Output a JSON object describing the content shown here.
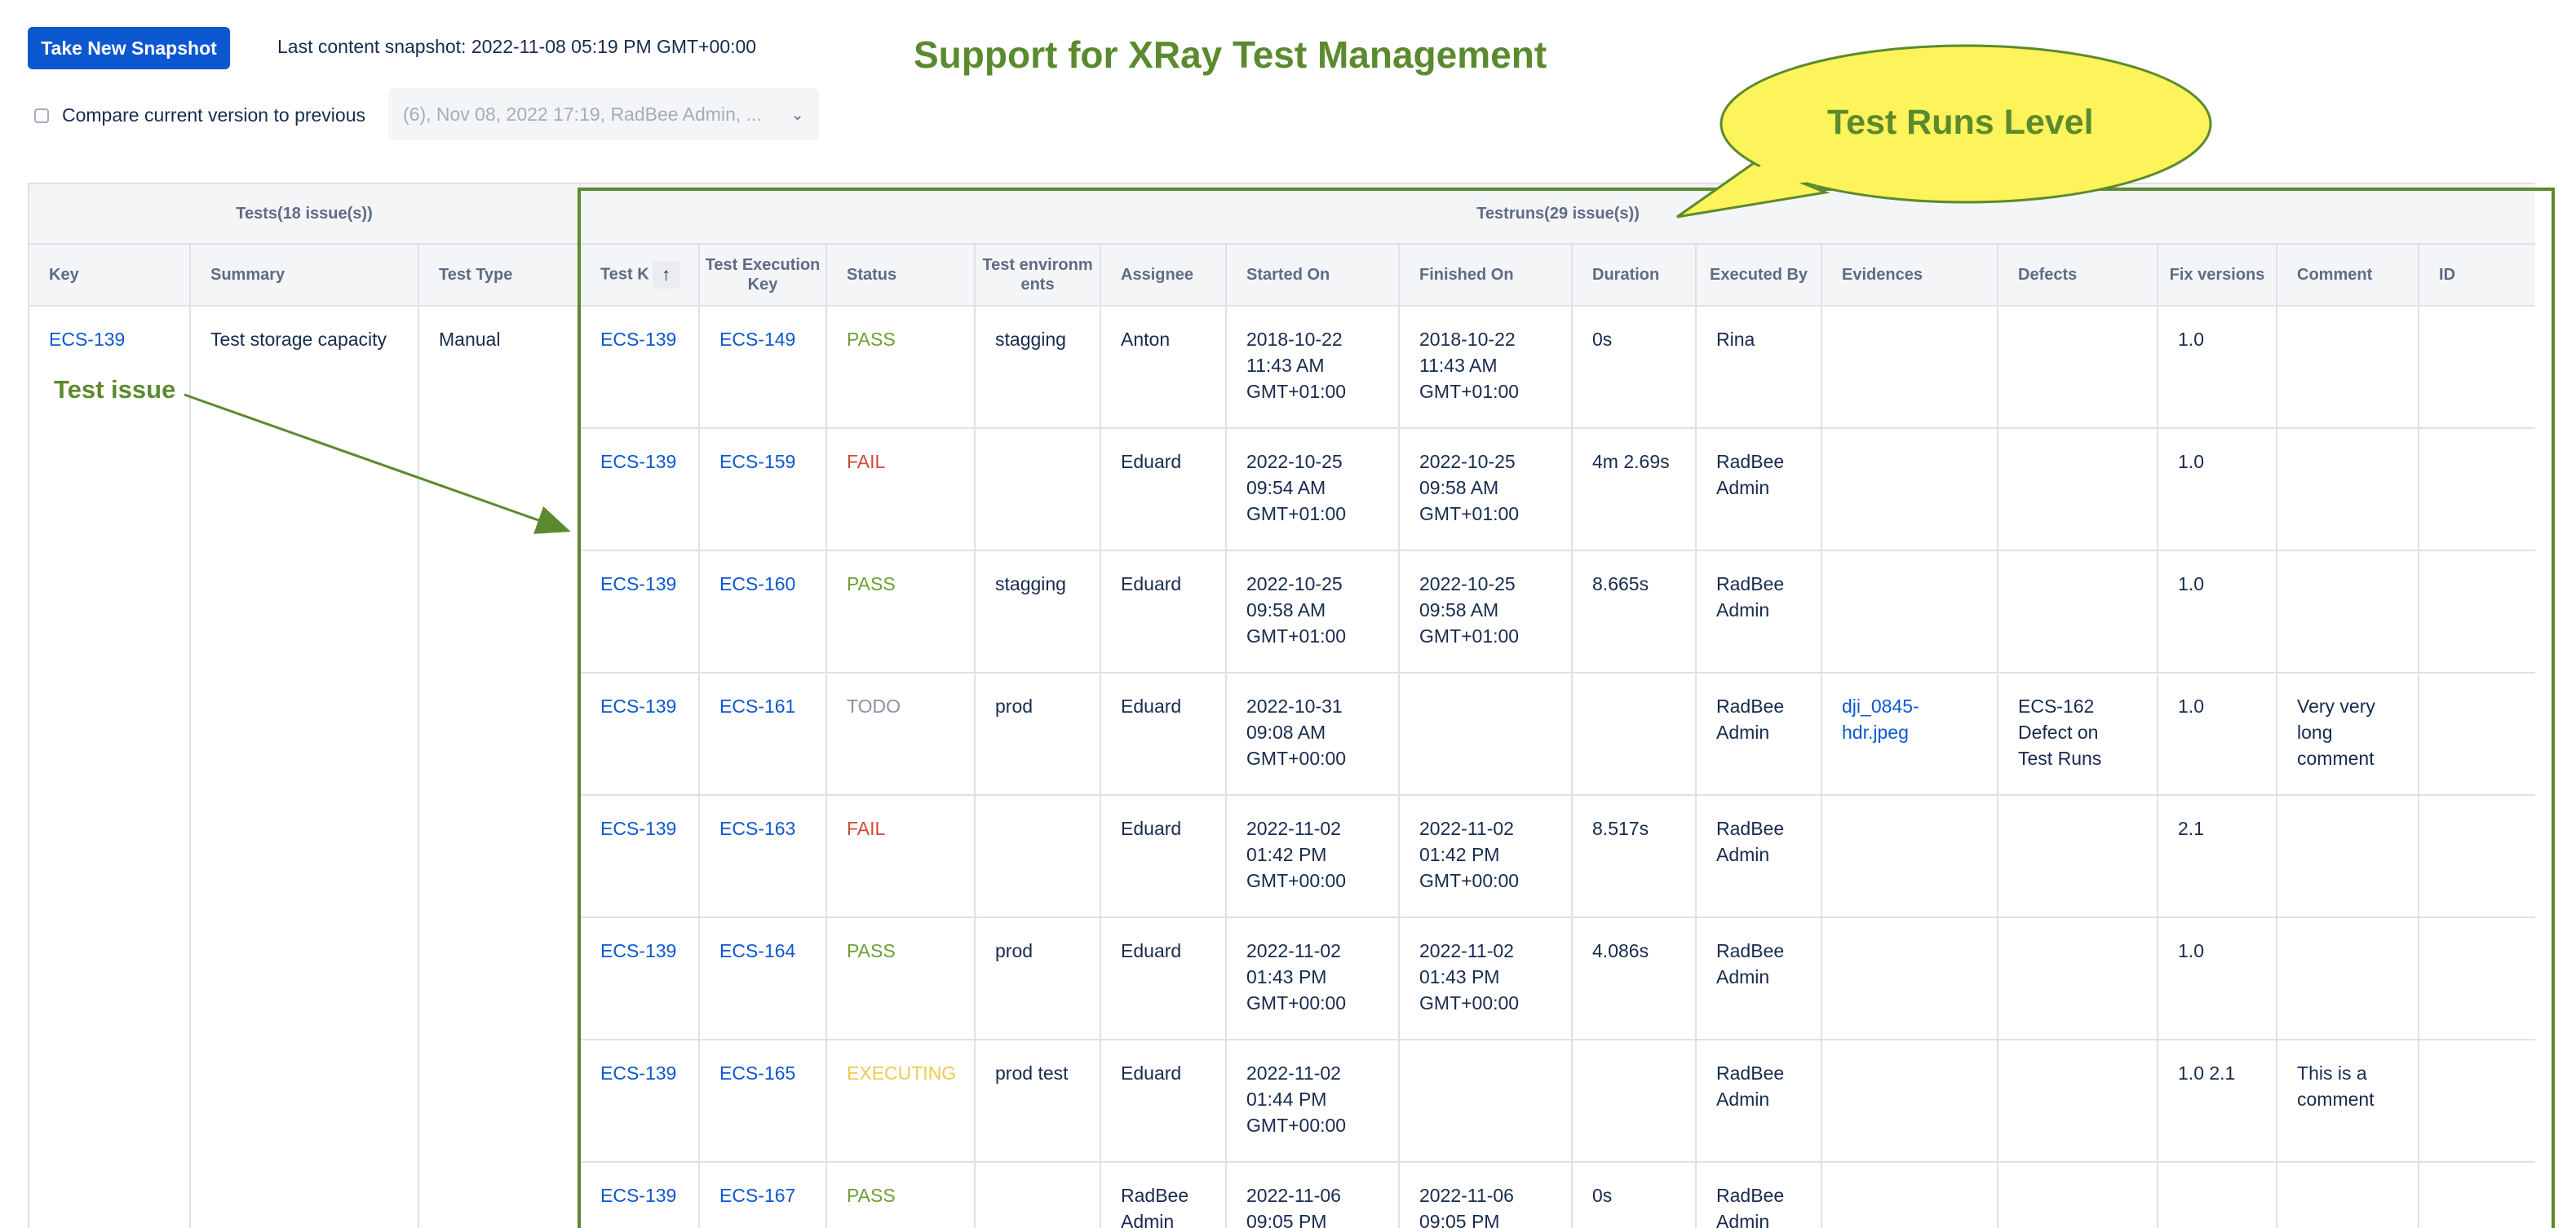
{
  "toolbar": {
    "snapshot_button": "Take New Snapshot",
    "last_snapshot": "Last content snapshot: 2022-11-08 05:19 PM GMT+00:00",
    "compare_label": "Compare current version to previous",
    "version_select_value": "(6), Nov 08, 2022 17:19, RadBee Admin, ..."
  },
  "annotations": {
    "title": "Support for XRay Test Management",
    "bubble": "Test Runs Level",
    "test_issue": "Test issue",
    "color": "#5b8a2e",
    "bubble_fill": "#fdf35a"
  },
  "table": {
    "groups": {
      "tests": "Tests(18 issue(s))",
      "testruns": "Testruns(29 issue(s))"
    },
    "columns": {
      "key": "Key",
      "summary": "Summary",
      "test_type": "Test Type",
      "test_key": "Test K",
      "test_exec_key": "Test Execution Key",
      "status": "Status",
      "test_env": "Test environments",
      "assignee": "Assignee",
      "started_on": "Started On",
      "finished_on": "Finished On",
      "duration": "Duration",
      "executed_by": "Executed By",
      "evidences": "Evidences",
      "defects": "Defects",
      "fix_versions": "Fix versions",
      "comment": "Comment",
      "id": "ID"
    },
    "test": {
      "key": "ECS-139",
      "summary": "Test storage capacity",
      "type": "Manual"
    },
    "runs": [
      {
        "test_key": "ECS-139",
        "exec_key": "ECS-149",
        "status": "PASS",
        "env": "stagging",
        "assignee": "Anton",
        "started": "2018-10-22 11:43 AM GMT+01:00",
        "finished": "2018-10-22 11:43 AM GMT+01:00",
        "duration": "0s",
        "executed_by": "Rina",
        "evidence": "",
        "defects": "",
        "fix": "1.0",
        "comment": ""
      },
      {
        "test_key": "ECS-139",
        "exec_key": "ECS-159",
        "status": "FAIL",
        "env": "",
        "assignee": "Eduard",
        "started": "2022-10-25 09:54 AM GMT+01:00",
        "finished": "2022-10-25 09:58 AM GMT+01:00",
        "duration": "4m 2.69s",
        "executed_by": "RadBee Admin",
        "evidence": "",
        "defects": "",
        "fix": "1.0",
        "comment": ""
      },
      {
        "test_key": "ECS-139",
        "exec_key": "ECS-160",
        "status": "PASS",
        "env": "stagging",
        "assignee": "Eduard",
        "started": "2022-10-25 09:58 AM GMT+01:00",
        "finished": "2022-10-25 09:58 AM GMT+01:00",
        "duration": "8.665s",
        "executed_by": "RadBee Admin",
        "evidence": "",
        "defects": "",
        "fix": "1.0",
        "comment": ""
      },
      {
        "test_key": "ECS-139",
        "exec_key": "ECS-161",
        "status": "TODO",
        "env": "prod",
        "assignee": "Eduard",
        "started": "2022-10-31 09:08 AM GMT+00:00",
        "finished": "",
        "duration": "",
        "executed_by": "RadBee Admin",
        "evidence": "dji_0845-hdr.jpeg",
        "defects": "ECS-162 Defect on Test Runs",
        "fix": "1.0",
        "comment": "Very very long comment"
      },
      {
        "test_key": "ECS-139",
        "exec_key": "ECS-163",
        "status": "FAIL",
        "env": "",
        "assignee": "Eduard",
        "started": "2022-11-02 01:42 PM GMT+00:00",
        "finished": "2022-11-02 01:42 PM GMT+00:00",
        "duration": "8.517s",
        "executed_by": "RadBee Admin",
        "evidence": "",
        "defects": "",
        "fix": "2.1",
        "comment": ""
      },
      {
        "test_key": "ECS-139",
        "exec_key": "ECS-164",
        "status": "PASS",
        "env": "prod",
        "assignee": "Eduard",
        "started": "2022-11-02 01:43 PM GMT+00:00",
        "finished": "2022-11-02 01:43 PM GMT+00:00",
        "duration": "4.086s",
        "executed_by": "RadBee Admin",
        "evidence": "",
        "defects": "",
        "fix": "1.0",
        "comment": ""
      },
      {
        "test_key": "ECS-139",
        "exec_key": "ECS-165",
        "status": "EXECUTING",
        "env": "prod test",
        "assignee": "Eduard",
        "started": "2022-11-02 01:44 PM GMT+00:00",
        "finished": "",
        "duration": "",
        "executed_by": "RadBee Admin",
        "evidence": "",
        "defects": "",
        "fix": "1.0 2.1",
        "comment": "This is a comment"
      },
      {
        "test_key": "ECS-139",
        "exec_key": "ECS-167",
        "status": "PASS",
        "env": "",
        "assignee": "RadBee Admin",
        "started": "2022-11-06 09:05 PM",
        "finished": "2022-11-06 09:05 PM",
        "duration": "0s",
        "executed_by": "RadBee Admin",
        "evidence": "",
        "defects": "",
        "fix": "",
        "comment": ""
      }
    ]
  }
}
